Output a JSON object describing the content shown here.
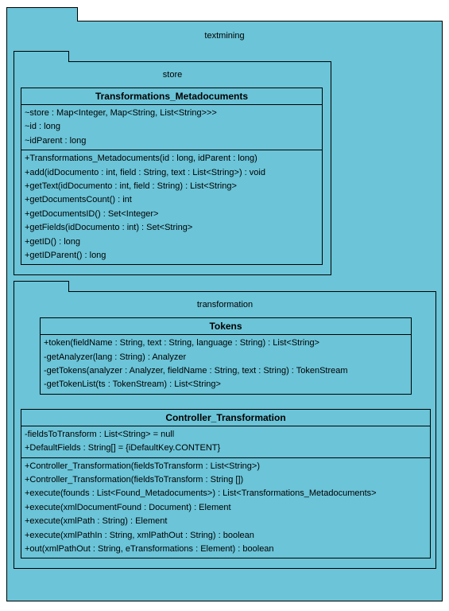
{
  "outer": {
    "title": "textmining"
  },
  "store": {
    "title": "store",
    "class1": {
      "name": "Transformations_Metadocuments",
      "attrs": [
        "~store : Map<Integer, Map<String, List<String>>>",
        "~id : long",
        "~idParent : long"
      ],
      "ops": [
        "+Transformations_Metadocuments(id : long, idParent : long)",
        "+add(idDocumento : int, field : String, text : List<String>) : void",
        "+getText(idDocumento : int, field : String) : List<String>",
        "+getDocumentsCount() : int",
        "+getDocumentsID() : Set<Integer>",
        "+getFields(idDocumento : int) : Set<String>",
        "+getID() : long",
        "+getIDParent() : long"
      ]
    }
  },
  "transformation": {
    "title": "transformation",
    "tokens": {
      "name": "Tokens",
      "ops": [
        "+token(fieldName : String, text : String, language : String) : List<String>",
        "-getAnalyzer(lang : String) : Analyzer",
        "-getTokens(analyzer : Analyzer, fieldName : String, text : String) : TokenStream",
        "-getTokenList(ts : TokenStream) : List<String>"
      ]
    },
    "controller": {
      "name": "Controller_Transformation",
      "attrs": [
        "-fieldsToTransform : List<String> = null",
        "+DefaultFields : String[] = {iDefaultKey.CONTENT}"
      ],
      "ops": [
        "+Controller_Transformation(fieldsToTransform : List<String>)",
        "+Controller_Transformation(fieldsToTransform : String [])",
        "+execute(founds : List<Found_Metadocuments>) : List<Transformations_Metadocuments>",
        "+execute(xmlDocumentFound : Document) : Element",
        "+execute(xmlPath : String) : Element",
        "+execute(xmlPathIn : String, xmlPathOut : String) : boolean",
        "+out(xmlPathOut : String, eTransformations : Element) : boolean"
      ]
    }
  }
}
